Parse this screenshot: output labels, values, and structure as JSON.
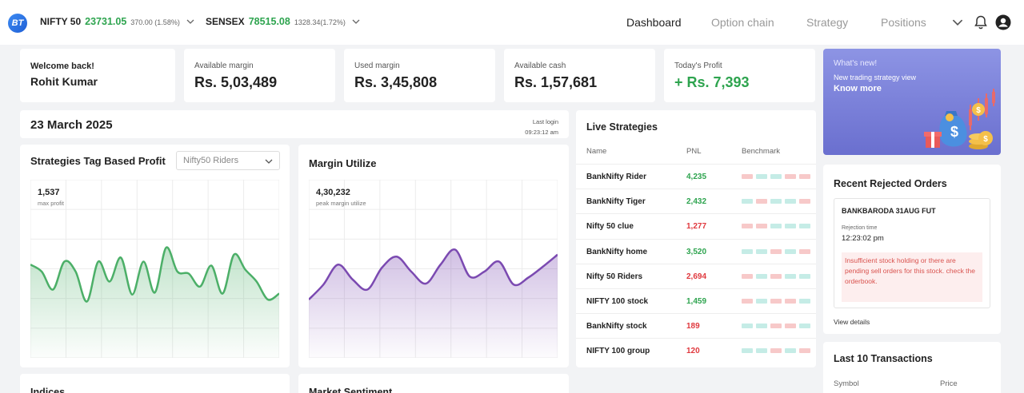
{
  "header": {
    "logo_text": "BT",
    "tickers": [
      {
        "name": "NIFTY 50",
        "value": "23731.05",
        "change": "370.00 (1.58%)"
      },
      {
        "name": "SENSEX",
        "value": "78515.08",
        "change": "1328.34(1.72%)"
      }
    ],
    "nav": [
      {
        "label": "Dashboard",
        "active": true
      },
      {
        "label": "Option chain",
        "active": false
      },
      {
        "label": "Strategy",
        "active": false
      },
      {
        "label": "Positions",
        "active": false
      }
    ]
  },
  "stats": {
    "welcome_label": "Welcome back!",
    "user_name": "Rohit Kumar",
    "available_margin_label": "Available margin",
    "available_margin": "Rs. 5,03,489",
    "used_margin_label": "Used margin",
    "used_margin": "Rs. 3,45,808",
    "available_cash_label": "Available cash",
    "available_cash": "Rs. 1,57,681",
    "today_profit_label": "Today's Profit",
    "today_profit": "+ Rs. 7,393"
  },
  "date_card": {
    "date": "23 March 2025",
    "last_login_label": "Last login",
    "last_login_time": "09:23:12 am"
  },
  "strategies_chart": {
    "title": "Strategies Tag Based Profit",
    "dropdown_value": "Nifty50 Riders",
    "max_value": "1,537",
    "max_label": "max profit",
    "line_color": "#4caf68"
  },
  "margin_chart": {
    "title": "Margin Utilize",
    "max_value": "4,30,232",
    "max_label": "peak margin utilize",
    "line_color": "#7b4ab1"
  },
  "chart_data": [
    {
      "type": "area",
      "title": "Strategies Tag Based Profit",
      "series": [
        {
          "values": [
            0.55,
            0.48,
            0.3,
            0.58,
            0.48,
            0.18,
            0.58,
            0.38,
            0.62,
            0.25,
            0.58,
            0.27,
            0.72,
            0.48,
            0.46,
            0.33,
            0.54,
            0.26,
            0.65,
            0.5,
            0.38,
            0.2,
            0.26
          ]
        }
      ]
    },
    {
      "type": "area",
      "title": "Margin Utilize",
      "series": [
        {
          "values": [
            0.2,
            0.35,
            0.55,
            0.4,
            0.3,
            0.52,
            0.63,
            0.48,
            0.36,
            0.55,
            0.7,
            0.43,
            0.48,
            0.58,
            0.35,
            0.42,
            0.53,
            0.65
          ]
        }
      ]
    }
  ],
  "live_strategies": {
    "title": "Live Strategies",
    "headers": [
      "Name",
      "PNL",
      "Benchmark"
    ],
    "rows": [
      {
        "name": "BankNifty Rider",
        "pnl": "4,235",
        "positive": true,
        "bench": [
          "r",
          "g",
          "g",
          "r",
          "r"
        ]
      },
      {
        "name": "BankNifty Tiger",
        "pnl": "2,432",
        "positive": true,
        "bench": [
          "g",
          "r",
          "g",
          "g",
          "r"
        ]
      },
      {
        "name": "Nifty 50 clue",
        "pnl": "1,277",
        "positive": false,
        "bench": [
          "r",
          "r",
          "g",
          "g",
          "g"
        ]
      },
      {
        "name": "BankNifty home",
        "pnl": "3,520",
        "positive": true,
        "bench": [
          "g",
          "g",
          "r",
          "g",
          "r"
        ]
      },
      {
        "name": "Nifty 50 Riders",
        "pnl": "2,694",
        "positive": false,
        "bench": [
          "r",
          "g",
          "r",
          "g",
          "g"
        ]
      },
      {
        "name": "NIFTY 100 stock",
        "pnl": "1,459",
        "positive": true,
        "bench": [
          "r",
          "g",
          "r",
          "r",
          "g"
        ]
      },
      {
        "name": "BankNifty stock",
        "pnl": "189",
        "positive": false,
        "bench": [
          "g",
          "g",
          "r",
          "r",
          "g"
        ]
      },
      {
        "name": "NIFTY 100 group",
        "pnl": "120",
        "positive": false,
        "bench": [
          "g",
          "g",
          "r",
          "g",
          "r"
        ]
      }
    ]
  },
  "promo": {
    "whats_new": "What's new!",
    "subtitle": "New trading  strategy view",
    "cta": "Know more"
  },
  "rejected_orders": {
    "title": "Recent Rejected Orders",
    "symbol": "BANKBARODA 31AUG FUT",
    "time_label": "Rejection time",
    "time": "12:23:02 pm",
    "error": "Insufficient stock holding or there are pending sell orders for this stock. check the orderbook.",
    "view_details": "View details"
  },
  "transactions": {
    "title": "Last 10 Transactions",
    "col_symbol": "Symbol",
    "col_price": "Price"
  },
  "bottom": {
    "indices_title": "Indices",
    "sentiment_title": "Market Sentiment"
  },
  "colors": {
    "green": "#2ea44f",
    "red": "#e0393e",
    "bench_red": "#f7c9c9",
    "bench_green": "#c5ece6"
  }
}
